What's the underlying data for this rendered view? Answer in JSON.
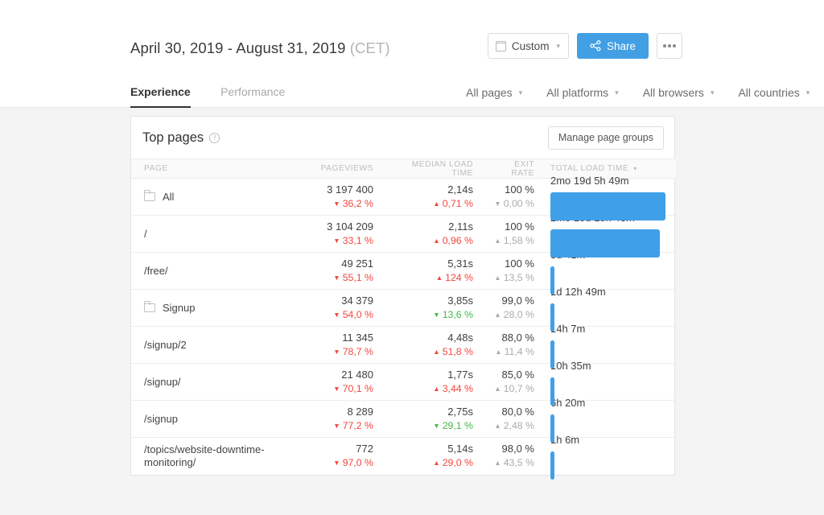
{
  "header": {
    "date_range": "April 30, 2019 - August 31, 2019",
    "timezone": "(CET)",
    "custom_button": "Custom",
    "share_button": "Share",
    "more_button": "•••",
    "calendar_icon": "calendar-icon",
    "share_icon": "share-nodes-icon"
  },
  "tabs": [
    {
      "label": "Experience",
      "active": true
    },
    {
      "label": "Performance",
      "active": false
    }
  ],
  "filters": [
    {
      "label": "All pages"
    },
    {
      "label": "All platforms"
    },
    {
      "label": "All browsers"
    },
    {
      "label": "All countries"
    }
  ],
  "card": {
    "title": "Top pages",
    "help_icon": "help-circle-icon",
    "manage_button": "Manage page groups",
    "columns": {
      "page": "PAGE",
      "pageviews": "PAGEVIEWS",
      "median_load_time": "MEDIAN LOAD TIME",
      "exit_rate": "EXIT RATE",
      "total_load_time": "TOTAL LOAD TIME"
    },
    "sorted_column": "TOTAL LOAD TIME",
    "rows": [
      {
        "page": "All",
        "is_group": true,
        "pageviews": "3 197 400",
        "pageviews_delta": "36,2 %",
        "pageviews_dir": "down",
        "pageviews_color": "red",
        "median": "2,14s",
        "median_delta": "0,71 %",
        "median_dir": "up",
        "median_color": "red",
        "exit": "100 %",
        "exit_delta": "0,00 %",
        "exit_dir": "down",
        "exit_color": "gray",
        "total": "2mo 19d 5h 49m",
        "total_pct": 100
      },
      {
        "page": "/",
        "is_group": false,
        "pageviews": "3 104 209",
        "pageviews_delta": "33,1 %",
        "pageviews_dir": "down",
        "pageviews_color": "red",
        "median": "2,11s",
        "median_delta": "0,96 %",
        "median_dir": "up",
        "median_color": "red",
        "exit": "100 %",
        "exit_delta": "1,58 %",
        "exit_dir": "up",
        "exit_color": "gray",
        "total": "2mo 15d 15h 43m",
        "total_pct": 95
      },
      {
        "page": "/free/",
        "is_group": false,
        "pageviews": "49 251",
        "pageviews_delta": "55,1 %",
        "pageviews_dir": "down",
        "pageviews_color": "red",
        "median": "5,31s",
        "median_delta": "124 %",
        "median_dir": "up",
        "median_color": "red",
        "exit": "100 %",
        "exit_delta": "13,5 %",
        "exit_dir": "up",
        "exit_color": "gray",
        "total": "3d 41m",
        "total_pct": 3.5
      },
      {
        "page": "Signup",
        "is_group": true,
        "pageviews": "34 379",
        "pageviews_delta": "54,0 %",
        "pageviews_dir": "down",
        "pageviews_color": "red",
        "median": "3,85s",
        "median_delta": "13,6 %",
        "median_dir": "down",
        "median_color": "green",
        "exit": "99,0 %",
        "exit_delta": "28,0 %",
        "exit_dir": "up",
        "exit_color": "gray",
        "total": "1d 12h 49m",
        "total_pct": 2.2
      },
      {
        "page": "/signup/2",
        "is_group": false,
        "pageviews": "11 345",
        "pageviews_delta": "78,7 %",
        "pageviews_dir": "down",
        "pageviews_color": "red",
        "median": "4,48s",
        "median_delta": "51,8 %",
        "median_dir": "up",
        "median_color": "red",
        "exit": "88,0 %",
        "exit_delta": "11,4 %",
        "exit_dir": "up",
        "exit_color": "gray",
        "total": "14h 7m",
        "total_pct": 1.2
      },
      {
        "page": "/signup/",
        "is_group": false,
        "pageviews": "21 480",
        "pageviews_delta": "70,1 %",
        "pageviews_dir": "down",
        "pageviews_color": "red",
        "median": "1,77s",
        "median_delta": "3,44 %",
        "median_dir": "up",
        "median_color": "red",
        "exit": "85,0 %",
        "exit_delta": "10,7 %",
        "exit_dir": "up",
        "exit_color": "gray",
        "total": "10h 35m",
        "total_pct": 0.9
      },
      {
        "page": "/signup",
        "is_group": false,
        "pageviews": "8 289",
        "pageviews_delta": "77,2 %",
        "pageviews_dir": "down",
        "pageviews_color": "red",
        "median": "2,75s",
        "median_delta": "29,1 %",
        "median_dir": "down",
        "median_color": "green",
        "exit": "80,0 %",
        "exit_delta": "2,48 %",
        "exit_dir": "up",
        "exit_color": "gray",
        "total": "6h 20m",
        "total_pct": 0.6
      },
      {
        "page": "/topics/website-downtime-monitoring/",
        "is_group": false,
        "pageviews": "772",
        "pageviews_delta": "97,0 %",
        "pageviews_dir": "down",
        "pageviews_color": "red",
        "median": "5,14s",
        "median_delta": "29,0 %",
        "median_dir": "up",
        "median_color": "red",
        "exit": "98,0 %",
        "exit_delta": "43,5 %",
        "exit_dir": "up",
        "exit_color": "gray",
        "total": "1h 6m",
        "total_pct": 0.15
      }
    ]
  },
  "colors": {
    "accent_blue": "#429fe3",
    "bar_blue": "#3f9fe8",
    "negative_red": "#f4453c",
    "positive_green": "#42b749",
    "muted_gray": "#ababab",
    "page_bg": "#f4f4f4"
  }
}
